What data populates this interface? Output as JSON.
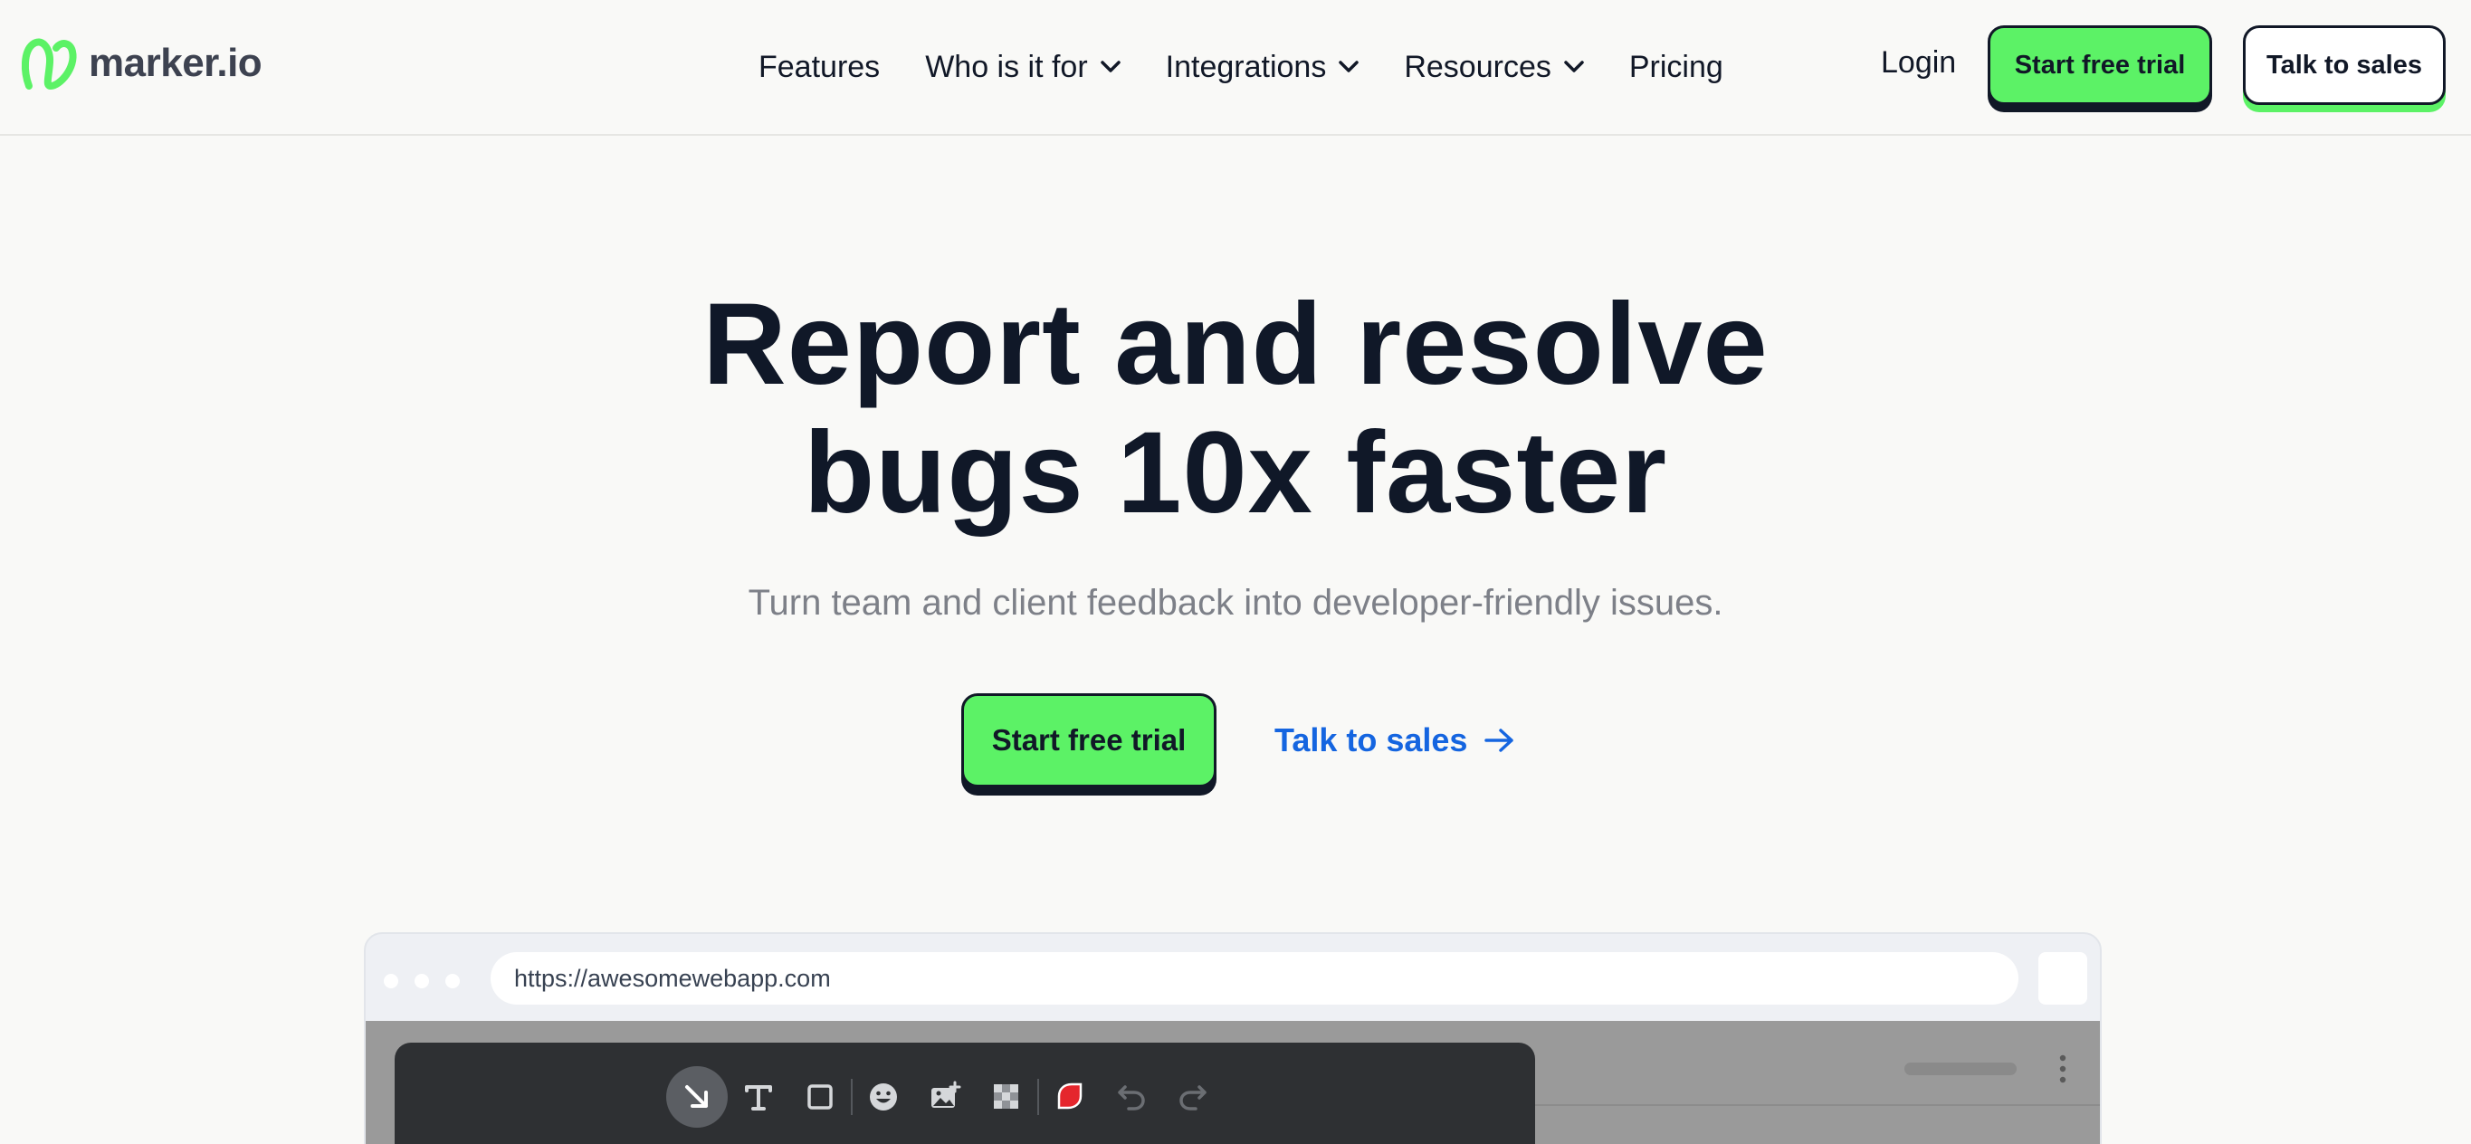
{
  "nav": {
    "logo_text": "marker.io",
    "brand_green": "#5cf266",
    "items": [
      {
        "label": "Features",
        "has_dropdown": false
      },
      {
        "label": "Who is it for",
        "has_dropdown": true
      },
      {
        "label": "Integrations",
        "has_dropdown": true
      },
      {
        "label": "Resources",
        "has_dropdown": true
      },
      {
        "label": "Pricing",
        "has_dropdown": false
      }
    ],
    "login_label": "Login",
    "trial_label": "Start free trial",
    "sales_label": "Talk to sales"
  },
  "hero": {
    "title_line1": "Report and resolve",
    "title_line2": "bugs 10x faster",
    "subtitle": "Turn team and client feedback into developer-friendly issues.",
    "trial_label": "Start free trial",
    "sales_label": "Talk to sales",
    "link_color": "#1565e0"
  },
  "browser": {
    "url": "https://awesomewebapp.com",
    "toolbar_icons": [
      "arrow-tool-icon",
      "text-tool-icon",
      "rectangle-tool-icon",
      "emoji-tool-icon",
      "image-tool-icon",
      "blur-tool-icon",
      "color-picker-icon",
      "undo-icon",
      "redo-icon"
    ],
    "selected_color": "#e5262d"
  }
}
